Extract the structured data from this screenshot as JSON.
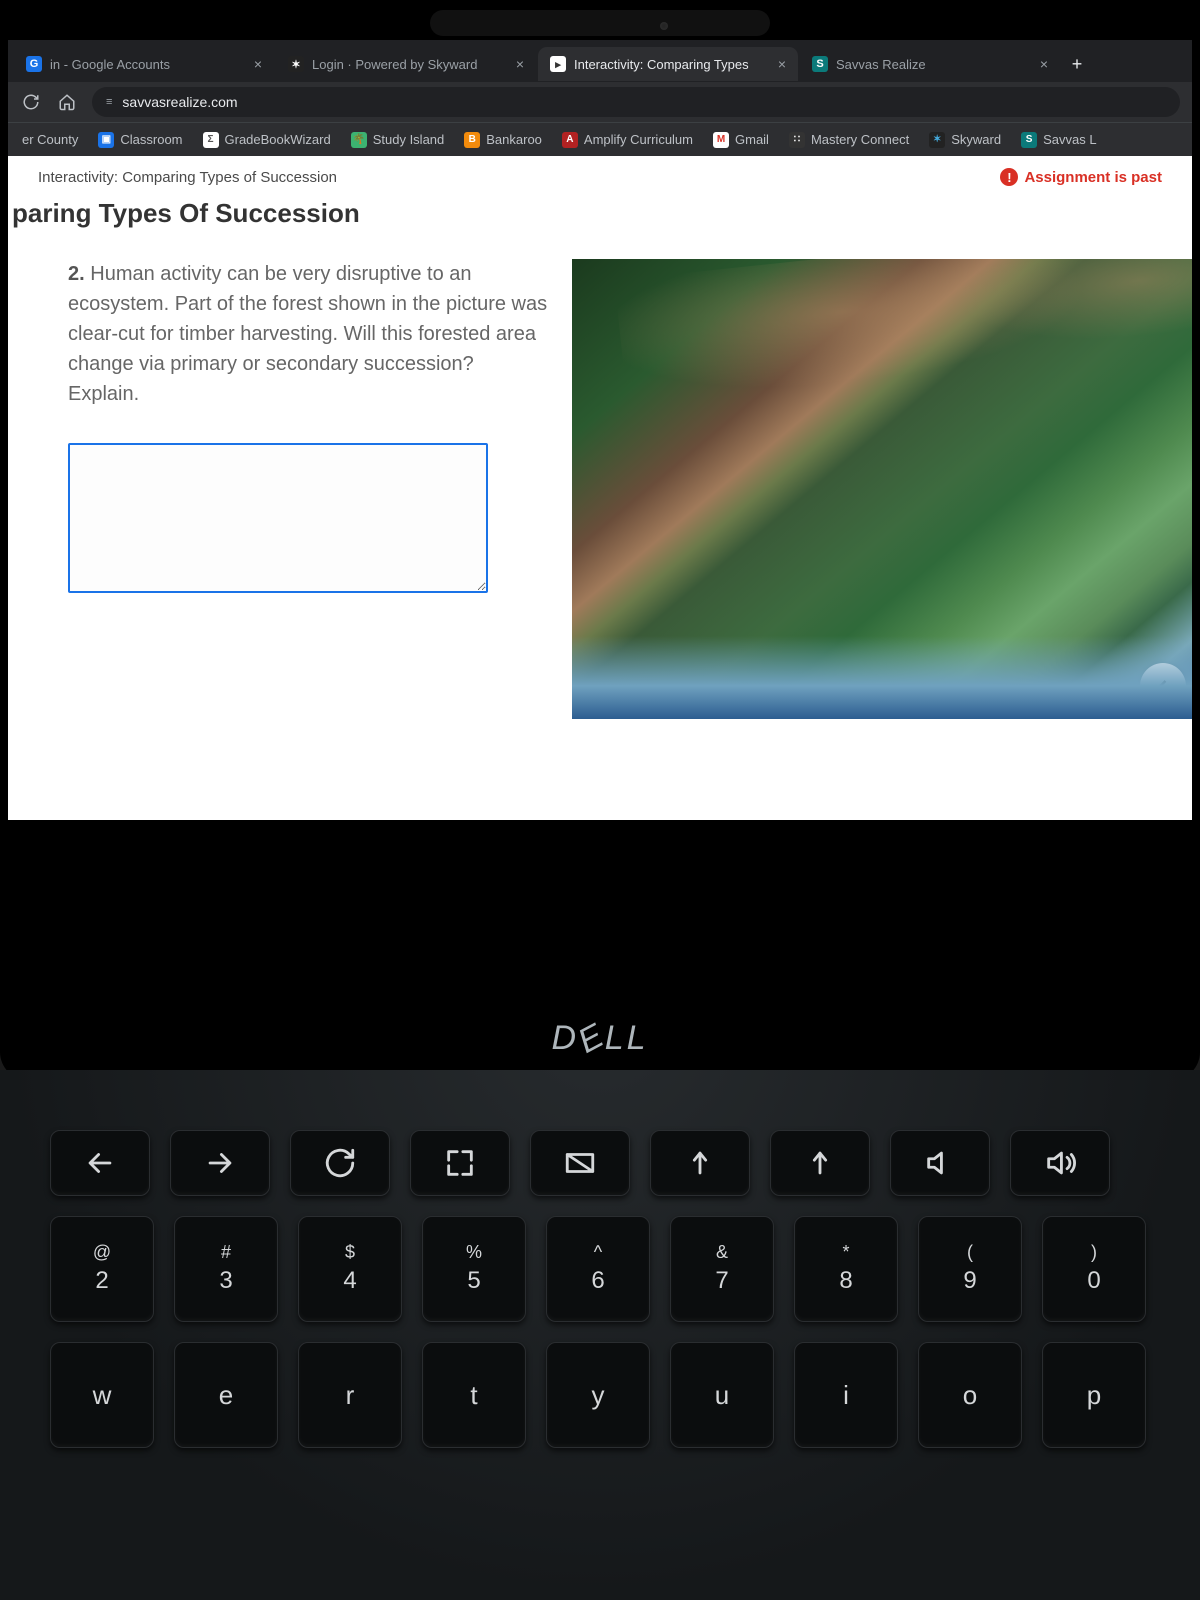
{
  "browser": {
    "tabs": [
      {
        "title": "in - Google Accounts",
        "favicon": "G",
        "active": false
      },
      {
        "title": "Login · Powered by Skyward",
        "favicon": "S",
        "active": false
      },
      {
        "title": "Interactivity: Comparing Types",
        "favicon": "►",
        "active": true
      },
      {
        "title": "Savvas Realize",
        "favicon": "S",
        "active": false
      }
    ],
    "address": "savvasrealize.com",
    "bookmarks": [
      {
        "label": "er County"
      },
      {
        "label": "Classroom"
      },
      {
        "label": "GradeBookWizard"
      },
      {
        "label": "Study Island"
      },
      {
        "label": "Bankaroo"
      },
      {
        "label": "Amplify Curriculum"
      },
      {
        "label": "Gmail"
      },
      {
        "label": "Mastery Connect"
      },
      {
        "label": "Skyward"
      },
      {
        "label": "Savvas L"
      }
    ]
  },
  "page": {
    "breadcrumb": "Interactivity: Comparing Types of Succession",
    "status": "Assignment is past",
    "title": "paring Types Of Succession",
    "question_number": "2.",
    "question_text": "Human activity can be very disruptive to an ecosystem. Part of the forest shown in the picture was clear-cut for timber harvesting. Will this forested area change via primary or secondary succession? Explain.",
    "image_alt": "Aerial photo of a forested mountainside with a large clear-cut patch of bare brown ground, bordered by dense green forest and a body of water in the foreground.",
    "answer_value": ""
  },
  "laptop": {
    "brand": "DELL"
  },
  "keyboard": {
    "fn_row": [
      "←",
      "→",
      "↻",
      "⛶",
      "◪",
      "✦",
      "✦",
      "🔇",
      "🔊"
    ],
    "num_row": [
      {
        "sym": "@",
        "dig": "2"
      },
      {
        "sym": "#",
        "dig": "3"
      },
      {
        "sym": "$",
        "dig": "4"
      },
      {
        "sym": "%",
        "dig": "5"
      },
      {
        "sym": "^",
        "dig": "6"
      },
      {
        "sym": "&",
        "dig": "7"
      },
      {
        "sym": "*",
        "dig": "8"
      },
      {
        "sym": "(",
        "dig": "9"
      },
      {
        "sym": ")",
        "dig": "0"
      }
    ],
    "alpha_row": [
      "w",
      "e",
      "r",
      "t",
      "y",
      "u",
      "i",
      "o",
      "p"
    ]
  }
}
